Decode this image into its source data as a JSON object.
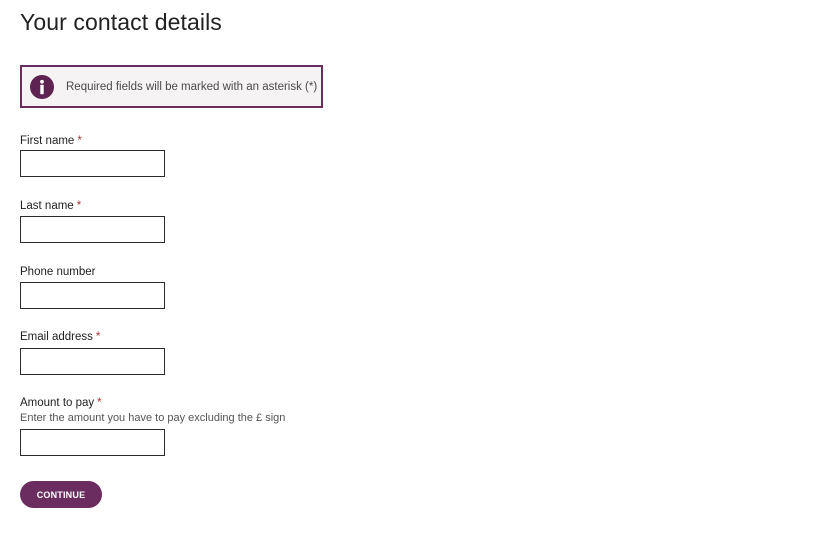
{
  "page": {
    "title": "Your contact details"
  },
  "notice": {
    "icon": "info-icon",
    "text": "Required fields will be marked with an asterisk (*)"
  },
  "form": {
    "first_name": {
      "label": "First name",
      "required_marker": "*",
      "value": ""
    },
    "last_name": {
      "label": "Last name",
      "required_marker": "*",
      "value": ""
    },
    "phone": {
      "label": "Phone number",
      "value": ""
    },
    "email": {
      "label": "Email address",
      "required_marker": "*",
      "value": ""
    },
    "amount": {
      "label": "Amount to pay",
      "required_marker": "*",
      "hint": "Enter the amount you have to pay excluding the £ sign",
      "value": ""
    },
    "continue_label": "CONTINUE"
  },
  "colors": {
    "accent": "#6b2c5f",
    "notice_background": "#f6f3f5",
    "required_marker": "#b5323a"
  }
}
